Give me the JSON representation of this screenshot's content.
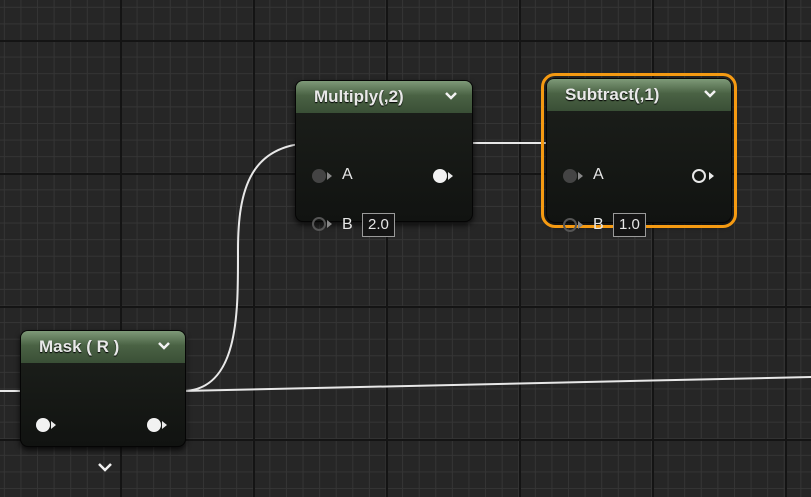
{
  "nodes": {
    "multiply": {
      "title": "Multiply(,2)",
      "pin_a": "A",
      "pin_b": "B",
      "b_value": "2.0"
    },
    "subtract": {
      "title": "Subtract(,1)",
      "pin_a": "A",
      "pin_b": "B",
      "b_value": "1.0"
    },
    "mask": {
      "title": "Mask ( R )"
    }
  },
  "icons": {
    "collapse": "chevron-down-icon",
    "expand": "chevron-down-icon"
  },
  "colors": {
    "header": "#4a6244",
    "selection": "#f59a12",
    "wire": "#e8e8e8",
    "grid_bg": "#262626"
  }
}
